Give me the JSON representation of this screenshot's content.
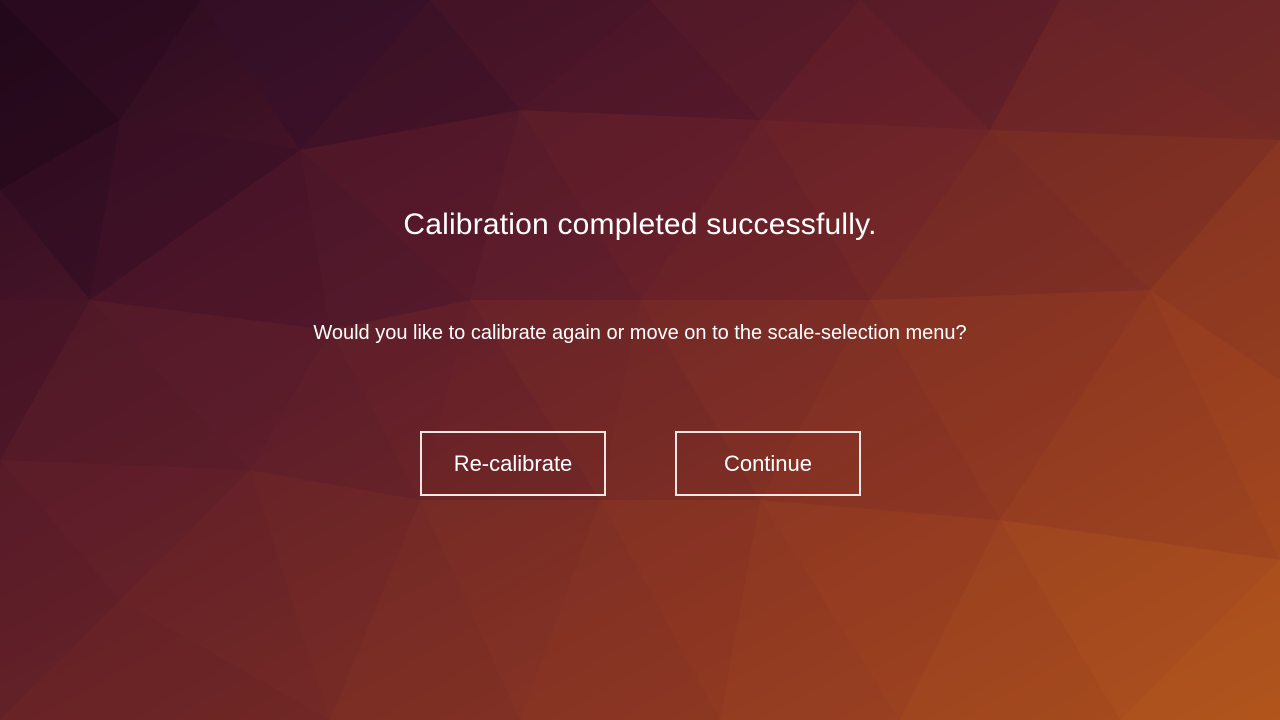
{
  "dialog": {
    "headline": "Calibration completed successfully.",
    "prompt": "Would you like to calibrate again or move on to the scale-selection menu?"
  },
  "buttons": {
    "recalibrate_label": "Re-calibrate",
    "continue_label": "Continue"
  },
  "colors": {
    "background_dark": "#2a0a1e",
    "background_mid": "#6e2528",
    "background_light": "#a8461f",
    "text": "#ffffff",
    "button_border": "#f4e6e2"
  }
}
